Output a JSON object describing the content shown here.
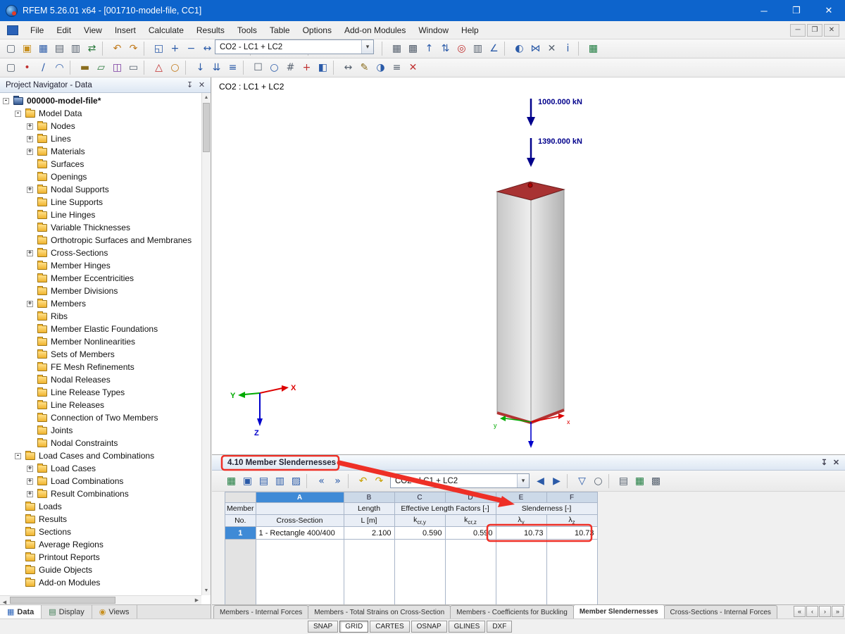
{
  "titlebar": {
    "title": "RFEM 5.26.01 x64 - [001710-model-file, CC1]",
    "min": "─",
    "max": "❐",
    "close": "✕"
  },
  "menubar": {
    "items": [
      "File",
      "Edit",
      "View",
      "Insert",
      "Calculate",
      "Results",
      "Tools",
      "Table",
      "Options",
      "Add-on Modules",
      "Window",
      "Help"
    ],
    "mdi": [
      "─",
      "❐",
      "✕"
    ]
  },
  "toolbar1": {
    "icons_a": [
      {
        "name": "new-file-icon",
        "glyph": "▢",
        "color": "#55606e"
      },
      {
        "name": "open-file-icon",
        "glyph": "▣",
        "color": "#c89020"
      },
      {
        "name": "save-icon",
        "glyph": "▦",
        "color": "#2a5aa8"
      },
      {
        "name": "print-icon",
        "glyph": "▤",
        "color": "#55606e"
      },
      {
        "name": "print-preview-icon",
        "glyph": "▥",
        "color": "#55606e"
      },
      {
        "name": "export-icon",
        "glyph": "⇄",
        "color": "#2a7a3c"
      },
      {
        "sep": true
      },
      {
        "name": "undo-icon",
        "glyph": "↶",
        "color": "#c07818"
      },
      {
        "name": "redo-icon",
        "glyph": "↷",
        "color": "#c07818"
      },
      {
        "sep": true
      },
      {
        "name": "zoom-window-icon",
        "glyph": "◱",
        "color": "#2a5aa8"
      },
      {
        "name": "zoom-in-icon",
        "glyph": "+",
        "color": "#2a5aa8"
      },
      {
        "name": "zoom-out-icon",
        "glyph": "−",
        "color": "#2a5aa8"
      },
      {
        "name": "pan-view-icon",
        "glyph": "↔",
        "color": "#2a5aa8"
      },
      {
        "name": "rotate-view-icon",
        "glyph": "↻",
        "color": "#2a5aa8"
      },
      {
        "name": "isometric-view-icon",
        "glyph": "◇",
        "color": "#55606e"
      },
      {
        "sep": true
      },
      {
        "name": "load-case-icon",
        "glyph": "Σ",
        "color": "#7a3aa0"
      }
    ],
    "combo_value": "CO2 - LC1 + LC2",
    "combo_arrow": "▾",
    "icons_b": [
      {
        "name": "previous-load-case-icon",
        "glyph": "◀",
        "color": "#2a5aa8"
      },
      {
        "name": "next-load-case-icon",
        "glyph": "▶",
        "color": "#2a5aa8"
      },
      {
        "sep": true
      },
      {
        "name": "show-results-icon",
        "glyph": "◉",
        "color": "#287a3c"
      },
      {
        "name": "result-values-icon",
        "glyph": "x.xx",
        "color": "#c03030"
      },
      {
        "name": "result-diagrams-icon",
        "glyph": "∿",
        "color": "#2a5aa8"
      },
      {
        "name": "superposition-icon",
        "glyph": "Σ",
        "color": "#2a5aa8"
      },
      {
        "sep": true
      },
      {
        "name": "fe-mesh-icon",
        "glyph": "▦",
        "color": "#55606e"
      },
      {
        "name": "mesh-settings-icon",
        "glyph": "▩",
        "color": "#55606e"
      },
      {
        "name": "move-up-icon",
        "glyph": "↑",
        "color": "#2a5aa8"
      },
      {
        "name": "swap-icon",
        "glyph": "⇅",
        "color": "#2a5aa8"
      },
      {
        "name": "target-icon",
        "glyph": "◎",
        "color": "#c03030"
      },
      {
        "name": "building-story-icon",
        "glyph": "▥",
        "color": "#55606e"
      },
      {
        "name": "measure-icon",
        "glyph": "∠",
        "color": "#2a5aa8"
      },
      {
        "sep": true
      },
      {
        "name": "visibility-icon",
        "glyph": "◐",
        "color": "#2a5aa8"
      },
      {
        "name": "mirror-icon",
        "glyph": "⋈",
        "color": "#2a5aa8"
      },
      {
        "name": "cut-plane-icon",
        "glyph": "✕",
        "color": "#55606e"
      },
      {
        "name": "info-icon",
        "glyph": "i",
        "color": "#2a5aa8"
      },
      {
        "sep": true
      },
      {
        "name": "excel-icon",
        "glyph": "▦",
        "color": "#1a7a3c"
      }
    ]
  },
  "toolbar2": {
    "icons": [
      {
        "name": "select-icon",
        "glyph": "▢",
        "color": "#55606e"
      },
      {
        "name": "draw-node-icon",
        "glyph": "•",
        "color": "#c03030"
      },
      {
        "name": "draw-line-icon",
        "glyph": "∕",
        "color": "#2a5aa8"
      },
      {
        "name": "draw-arc-icon",
        "glyph": "◠",
        "color": "#2a5aa8"
      },
      {
        "sep": true
      },
      {
        "name": "new-member-icon",
        "glyph": "▬",
        "color": "#8a6d1e"
      },
      {
        "name": "new-surface-icon",
        "glyph": "▱",
        "color": "#2a7a3c"
      },
      {
        "name": "new-solid-icon",
        "glyph": "◫",
        "color": "#7a3aa0"
      },
      {
        "name": "new-opening-icon",
        "glyph": "▭",
        "color": "#55606e"
      },
      {
        "sep": true
      },
      {
        "name": "nodal-support-icon",
        "glyph": "△",
        "color": "#c03030"
      },
      {
        "name": "member-hinge-icon",
        "glyph": "○",
        "color": "#c07818"
      },
      {
        "sep": true
      },
      {
        "name": "nodal-load-icon",
        "glyph": "↓",
        "color": "#2a5aa8"
      },
      {
        "name": "line-load-icon",
        "glyph": "⇊",
        "color": "#2a5aa8"
      },
      {
        "name": "area-load-icon",
        "glyph": "≡",
        "color": "#2a5aa8"
      },
      {
        "sep": true
      },
      {
        "name": "select-special-icon",
        "glyph": "☐",
        "color": "#55606e"
      },
      {
        "name": "zoom-all-icon",
        "glyph": "○",
        "color": "#2a5aa8"
      },
      {
        "name": "grid-icon",
        "glyph": "#",
        "color": "#55606e"
      },
      {
        "name": "snap-icon",
        "glyph": "+",
        "color": "#c03030"
      },
      {
        "name": "work-plane-icon",
        "glyph": "◧",
        "color": "#2a5aa8"
      },
      {
        "sep": true
      },
      {
        "name": "dimension-icon",
        "glyph": "↔",
        "color": "#55606e"
      },
      {
        "name": "comment-icon",
        "glyph": "✎",
        "color": "#8a6d1e"
      },
      {
        "name": "visibility-mode-icon",
        "glyph": "◑",
        "color": "#2a5aa8"
      },
      {
        "name": "layers-icon",
        "glyph": "≡",
        "color": "#55606e"
      },
      {
        "name": "delete-icon",
        "glyph": "✕",
        "color": "#c03030"
      }
    ]
  },
  "navigator": {
    "header": "Project Navigator - Data",
    "pin": "↧",
    "close": "✕",
    "tree": [
      {
        "label": "000000-model-file*",
        "level": 0,
        "exp": "-",
        "cls": "root-item",
        "bold": true
      },
      {
        "label": "Model Data",
        "level": 1,
        "exp": "-"
      },
      {
        "label": "Nodes",
        "level": 2,
        "exp": "+"
      },
      {
        "label": "Lines",
        "level": 2,
        "exp": "+"
      },
      {
        "label": "Materials",
        "level": 2,
        "exp": "+"
      },
      {
        "label": "Surfaces",
        "level": 2,
        "exp": ""
      },
      {
        "label": "Openings",
        "level": 2,
        "exp": ""
      },
      {
        "label": "Nodal Supports",
        "level": 2,
        "exp": "+"
      },
      {
        "label": "Line Supports",
        "level": 2,
        "exp": ""
      },
      {
        "label": "Line Hinges",
        "level": 2,
        "exp": ""
      },
      {
        "label": "Variable Thicknesses",
        "level": 2,
        "exp": ""
      },
      {
        "label": "Orthotropic Surfaces and Membranes",
        "level": 2,
        "exp": ""
      },
      {
        "label": "Cross-Sections",
        "level": 2,
        "exp": "+"
      },
      {
        "label": "Member Hinges",
        "level": 2,
        "exp": ""
      },
      {
        "label": "Member Eccentricities",
        "level": 2,
        "exp": ""
      },
      {
        "label": "Member Divisions",
        "level": 2,
        "exp": ""
      },
      {
        "label": "Members",
        "level": 2,
        "exp": "+"
      },
      {
        "label": "Ribs",
        "level": 2,
        "exp": ""
      },
      {
        "label": "Member Elastic Foundations",
        "level": 2,
        "exp": ""
      },
      {
        "label": "Member Nonlinearities",
        "level": 2,
        "exp": ""
      },
      {
        "label": "Sets of Members",
        "level": 2,
        "exp": ""
      },
      {
        "label": "FE Mesh Refinements",
        "level": 2,
        "exp": ""
      },
      {
        "label": "Nodal Releases",
        "level": 2,
        "exp": ""
      },
      {
        "label": "Line Release Types",
        "level": 2,
        "exp": ""
      },
      {
        "label": "Line Releases",
        "level": 2,
        "exp": ""
      },
      {
        "label": "Connection of Two Members",
        "level": 2,
        "exp": ""
      },
      {
        "label": "Joints",
        "level": 2,
        "exp": ""
      },
      {
        "label": "Nodal Constraints",
        "level": 2,
        "exp": ""
      },
      {
        "label": "Load Cases and Combinations",
        "level": 1,
        "exp": "-"
      },
      {
        "label": "Load Cases",
        "level": 2,
        "exp": "+"
      },
      {
        "label": "Load Combinations",
        "level": 2,
        "exp": "+"
      },
      {
        "label": "Result Combinations",
        "level": 2,
        "exp": "+"
      },
      {
        "label": "Loads",
        "level": 1,
        "exp": ""
      },
      {
        "label": "Results",
        "level": 1,
        "exp": ""
      },
      {
        "label": "Sections",
        "level": 1,
        "exp": ""
      },
      {
        "label": "Average Regions",
        "level": 1,
        "exp": ""
      },
      {
        "label": "Printout Reports",
        "level": 1,
        "exp": ""
      },
      {
        "label": "Guide Objects",
        "level": 1,
        "exp": ""
      },
      {
        "label": "Add-on Modules",
        "level": 1,
        "exp": ""
      }
    ],
    "tabs": [
      {
        "label": "Data",
        "glyph": "▦",
        "color": "#2a62b8",
        "active": true,
        "name": "nav-tab-data"
      },
      {
        "label": "Display",
        "glyph": "▤",
        "color": "#3a7a50",
        "name": "nav-tab-display"
      },
      {
        "label": "Views",
        "glyph": "◉",
        "color": "#c89020",
        "name": "nav-tab-views"
      }
    ]
  },
  "viewport": {
    "caption": "CO2 : LC1 + LC2",
    "load1_label": "1000.000 kN",
    "load2_label": "1390.000 kN",
    "axis_x": "X",
    "axis_y": "Y",
    "axis_z": "Z",
    "base_axis_x": "x",
    "base_axis_y": "y",
    "load_color": "#00008b",
    "column_top_color": "#a83232"
  },
  "tablepanel": {
    "title": "4.10 Member Slendernesses",
    "pin": "↧",
    "close": "✕",
    "icons_a": [
      {
        "name": "table-settings-icon",
        "glyph": "▦",
        "color": "#1a7a3c"
      },
      {
        "name": "expand-table-icon",
        "glyph": "▣",
        "color": "#2a5aa8"
      },
      {
        "name": "rows-filter-icon",
        "glyph": "▤",
        "color": "#2a5aa8"
      },
      {
        "name": "columns-filter-icon",
        "glyph": "▥",
        "color": "#2a5aa8"
      },
      {
        "name": "result-rows-icon",
        "glyph": "▨",
        "color": "#2a5aa8"
      },
      {
        "sep": true
      },
      {
        "name": "first-row-icon",
        "glyph": "«",
        "color": "#2a5aa8"
      },
      {
        "name": "last-row-icon",
        "glyph": "»",
        "color": "#2a5aa8"
      },
      {
        "sep": true
      },
      {
        "name": "undo-icon",
        "glyph": "↶",
        "color": "#c8a000"
      },
      {
        "name": "redo-icon",
        "glyph": "↷",
        "color": "#c8a000"
      }
    ],
    "combo_value": "CO2 - LC1 + LC2",
    "combo_arrow": "▾",
    "icons_b": [
      {
        "name": "previous-table-icon",
        "glyph": "◀",
        "color": "#2a5aa8"
      },
      {
        "name": "next-table-icon",
        "glyph": "▶",
        "color": "#2a5aa8"
      },
      {
        "sep": true
      },
      {
        "name": "filter-icon",
        "glyph": "▽",
        "color": "#2a5aa8"
      },
      {
        "name": "search-icon",
        "glyph": "○",
        "color": "#55606e"
      },
      {
        "sep": true
      },
      {
        "name": "print-icon",
        "glyph": "▤",
        "color": "#55606e"
      },
      {
        "name": "excel-export-icon",
        "glyph": "▦",
        "color": "#1a7a3c"
      },
      {
        "name": "calculator-icon",
        "glyph": "▩",
        "color": "#55606e"
      }
    ],
    "letters": [
      "A",
      "B",
      "C",
      "D",
      "E",
      "F"
    ],
    "head": {
      "member": "Member",
      "no": "No.",
      "cross_section": "Cross-Section",
      "length": "Length",
      "length_unit": "L [m]",
      "elf": "Effective Length Factors [-]",
      "k": "k",
      "kcry_sub": "cr,y",
      "kcrz_sub": "cr,z",
      "slender": "Slenderness [-]",
      "lambda": "λ",
      "ly_sub": "y",
      "lz_sub": "z"
    },
    "row": {
      "no": "1",
      "cs": "1 - Rectangle 400/400",
      "len": "2.100",
      "kcry": "0.590",
      "kcrz": "0.590",
      "ly": "10.73",
      "lz": "10.73"
    },
    "tabs": [
      {
        "label": "Members - Internal Forces"
      },
      {
        "label": "Members - Total Strains on Cross-Section"
      },
      {
        "label": "Members - Coefficients for Buckling"
      },
      {
        "label": "Member Slendernesses",
        "active": true
      },
      {
        "label": "Cross-Sections - Internal Forces"
      }
    ],
    "tab_nav": [
      {
        "name": "first-table-tab-button",
        "glyph": "«"
      },
      {
        "name": "prev-table-tab-button",
        "glyph": "‹"
      },
      {
        "name": "next-table-tab-button",
        "glyph": "›"
      },
      {
        "name": "last-table-tab-button",
        "glyph": "»"
      }
    ],
    "annotation_color": "#ee2f26"
  },
  "statusbar": {
    "buttons": [
      {
        "label": "SNAP"
      },
      {
        "label": "GRID",
        "pressed": true
      },
      {
        "label": "CARTES"
      },
      {
        "label": "OSNAP"
      },
      {
        "label": "GLINES"
      },
      {
        "label": "DXF"
      }
    ]
  }
}
